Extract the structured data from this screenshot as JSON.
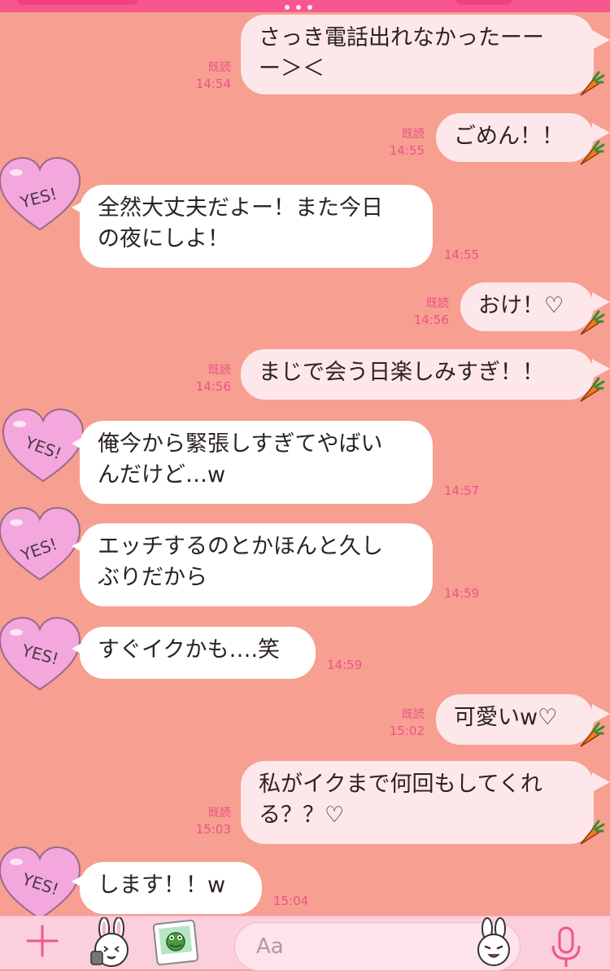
{
  "colors": {
    "background": "#f79f90",
    "accent": "#f7568f",
    "outgoing_bubble": "#fde7ea",
    "incoming_bubble": "#ffffff",
    "meta_text": "#e9548a"
  },
  "messages": [
    {
      "dir": "out",
      "text": "さっき電話出れなかったーー\nー＞＜",
      "read": "既読",
      "time": "14:54"
    },
    {
      "dir": "out",
      "text": "ごめん！！",
      "read": "既読",
      "time": "14:55"
    },
    {
      "dir": "in",
      "text": "全然大丈夫だよー！また今日\nの夜にしよ！",
      "time": "14:55",
      "avatar_text": "YES!"
    },
    {
      "dir": "out",
      "text": "おけ！♡",
      "read": "既読",
      "time": "14:56"
    },
    {
      "dir": "out",
      "text": "まじで会う日楽しみすぎ！！",
      "read": "既読",
      "time": "14:56"
    },
    {
      "dir": "in",
      "text": "俺今から緊張しすぎてやばい\nんだけど…w",
      "time": "14:57",
      "avatar_text": "YES!"
    },
    {
      "dir": "in",
      "text": "エッチするのとかほんと久し\nぶりだから",
      "time": "14:59",
      "avatar_text": "YES!"
    },
    {
      "dir": "in",
      "text": "すぐイクかも….笑",
      "time": "14:59",
      "avatar_text": "YES!"
    },
    {
      "dir": "out",
      "text": "可愛いw♡",
      "read": "既読",
      "time": "15:02"
    },
    {
      "dir": "out",
      "text": "私がイクまで何回もしてくれ\nる？？♡",
      "read": "既読",
      "time": "15:03"
    },
    {
      "dir": "in",
      "text": "します！！w",
      "time": "15:04",
      "avatar_text": "YES!"
    }
  ],
  "input": {
    "placeholder": "Aa"
  },
  "icons": {
    "plus": "plus-icon",
    "sticker": "bunny-sticker-icon",
    "photo": "photo-icon",
    "emoji": "bunny-emoji-icon",
    "mic": "microphone-icon",
    "carrot": "carrot-icon",
    "avatar": "heart-yes-avatar"
  }
}
